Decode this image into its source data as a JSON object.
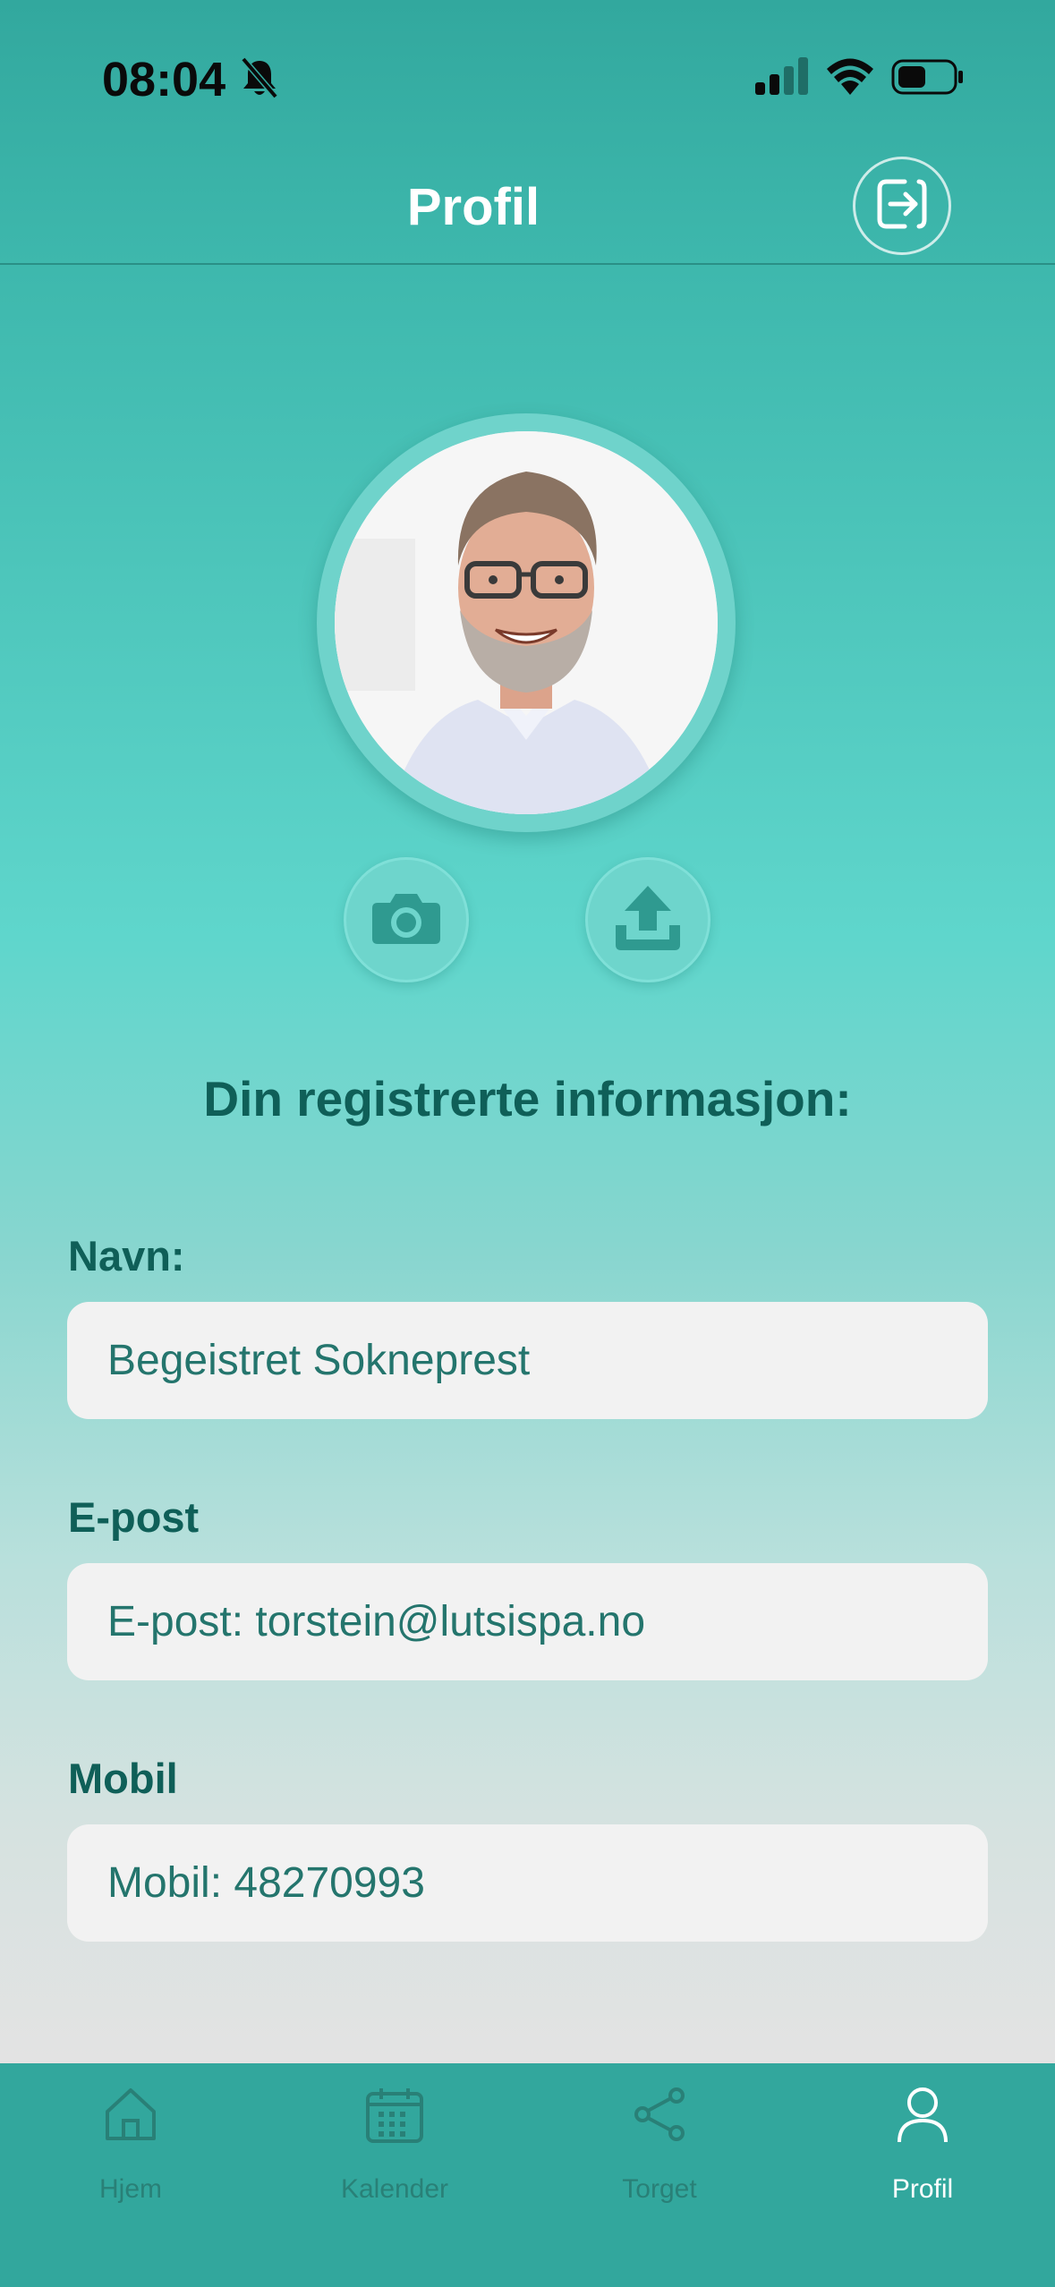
{
  "status_bar": {
    "time": "08:04"
  },
  "header": {
    "title": "Profil"
  },
  "profile": {
    "section_heading": "Din registrerte informasjon:",
    "fields": [
      {
        "label": "Navn:",
        "value": "Begeistret Sokneprest"
      },
      {
        "label": "E-post",
        "value": "E-post: torstein@lutsispa.no"
      },
      {
        "label": "Mobil",
        "value": "Mobil: 48270993"
      }
    ]
  },
  "tabs": [
    {
      "label": "Hjem",
      "icon": "home-icon",
      "active": false
    },
    {
      "label": "Kalender",
      "icon": "calendar-icon",
      "active": false
    },
    {
      "label": "Torget",
      "icon": "share-icon",
      "active": false
    },
    {
      "label": "Profil",
      "icon": "person-icon",
      "active": true
    }
  ],
  "colors": {
    "header_teal": "#32a89e",
    "accent_dark_teal": "#0f5f58",
    "field_text": "#24756d",
    "tab_inactive": "#298077",
    "tab_active": "#ffffff"
  }
}
